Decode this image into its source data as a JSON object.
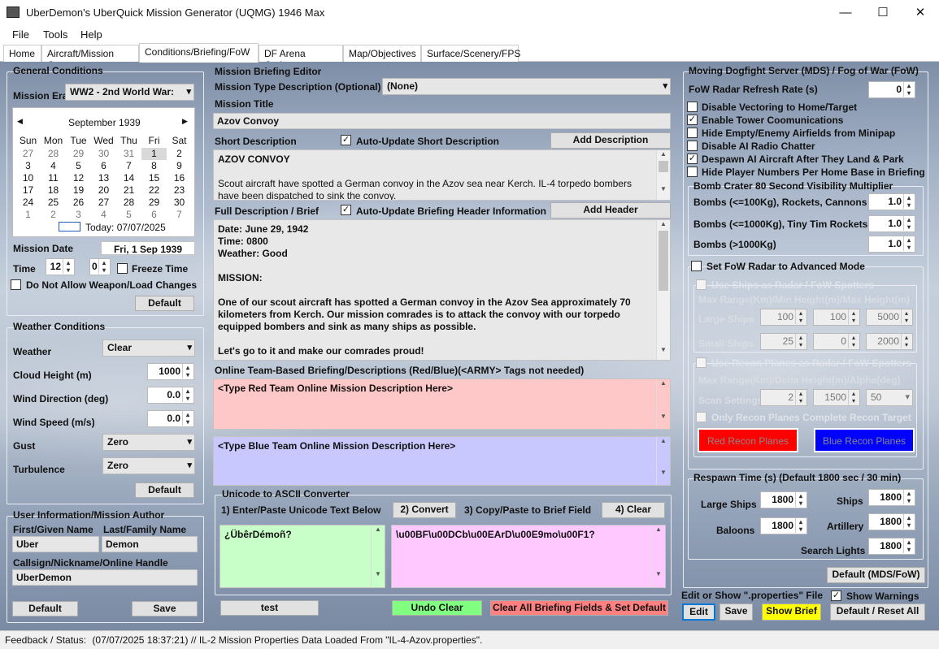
{
  "window": {
    "title": "UberDemon's UberQuick Mission Generator (UQMG) 1946 Max",
    "minimize": "—",
    "maximize": "☐",
    "close": "✕"
  },
  "menu": [
    "File",
    "Tools",
    "Help"
  ],
  "tabs": [
    "Home",
    "Aircraft/Mission Gen",
    "Conditions/Briefing/FoW",
    "DF Arena Options",
    "Map/Objectives",
    "Surface/Scenery/FPS"
  ],
  "general": {
    "title": "General Conditions",
    "era_label": "Mission Era",
    "era_value": "WW2 - 2nd World War:",
    "calendar": {
      "month": "September 1939",
      "prev": "◀",
      "next": "▶",
      "days": [
        "Sun",
        "Mon",
        "Tue",
        "Wed",
        "Thu",
        "Fri",
        "Sat"
      ],
      "weeks": [
        [
          "27",
          "28",
          "29",
          "30",
          "31",
          "1",
          "2"
        ],
        [
          "3",
          "4",
          "5",
          "6",
          "7",
          "8",
          "9"
        ],
        [
          "10",
          "11",
          "12",
          "13",
          "14",
          "15",
          "16"
        ],
        [
          "17",
          "18",
          "19",
          "20",
          "21",
          "22",
          "23"
        ],
        [
          "24",
          "25",
          "26",
          "27",
          "28",
          "29",
          "30"
        ],
        [
          "1",
          "2",
          "3",
          "4",
          "5",
          "6",
          "7"
        ]
      ],
      "today": "Today: 07/07/2025"
    },
    "date_label": "Mission Date",
    "date_value": "Fri, 1 Sep 1939",
    "time_label": "Time",
    "hour": "12",
    "minute": "0",
    "freeze_label": "Freeze Time",
    "no_weapon_label": "Do Not Allow Weapon/Load Changes",
    "default_btn": "Default"
  },
  "weather": {
    "title": "Weather Conditions",
    "weather_label": "Weather",
    "weather_value": "Clear",
    "cloud_label": "Cloud Height (m)",
    "cloud_value": "1000",
    "winddir_label": "Wind Direction (deg)",
    "winddir_value": "0.0",
    "windspeed_label": "Wind Speed (m/s)",
    "windspeed_value": "0.0",
    "gust_label": "Gust",
    "gust_value": "Zero",
    "turb_label": "Turbulence",
    "turb_value": "Zero",
    "default_btn": "Default"
  },
  "author": {
    "title": "User Information/Mission Author",
    "first_label": "First/Given Name",
    "first_value": "Uber",
    "last_label": "Last/Family Name",
    "last_value": "Demon",
    "callsign_label": "Callsign/Nickname/Online Handle",
    "callsign_value": "UberDemon",
    "default_btn": "Default",
    "save_btn": "Save"
  },
  "briefing": {
    "title": "Mission Briefing Editor",
    "type_label": "Mission Type Description (Optional)",
    "type_value": "(None)",
    "mtitle_label": "Mission Title",
    "mtitle_value": "Azov Convoy",
    "short_label": "Short Description",
    "auto_short_label": "Auto-Update Short Description",
    "add_desc_btn": "Add Description",
    "short_lines": [
      "AZOV CONVOY",
      "",
      "Scout aircraft have spotted a German convoy in the Azov sea near Kerch. IL-4 torpedo bombers",
      "have been dispatched to sink the convoy."
    ],
    "full_label": "Full Description / Brief",
    "auto_header_label": "Auto-Update Briefing Header Information",
    "add_header_btn": "Add Header",
    "full_lines": [
      "Date: June 29, 1942",
      "Time: 0800",
      "Weather: Good",
      "",
      "MISSION:",
      "",
      "One of our scout aircraft has spotted a German convoy in the Azov Sea approximately 70",
      "kilometers from Kerch. Our mission comrades is to attack the convoy with our torpedo",
      "equipped bombers and sink as many ships as possible.",
      "",
      "Let's go to it and make our comrades proud!"
    ],
    "online_label": "Online Team-Based Briefing/Descriptions (Red/Blue)(<ARMY> Tags not needed)",
    "red_text": "<Type Red Team Online Mission Description Here>",
    "blue_text": "<Type Blue Team Online Mission Description Here>",
    "unicode_title": "Unicode to ASCII Converter",
    "step1": "1) Enter/Paste Unicode Text Below",
    "convert_btn": "2) Convert",
    "step3": "3) Copy/Paste to Brief Field",
    "clear_btn": "4) Clear",
    "unicode_in": "¿ÜbêrDémoñ?",
    "unicode_out": "\\u00BF\\u00DCb\\u00EArD\\u00E9mo\\u00F1?",
    "test_btn": "test",
    "undo_btn": "Undo Clear",
    "clear_all_btn": "Clear All Briefing Fields & Set Default"
  },
  "fow": {
    "title": "Moving Dogfight Server (MDS) / Fog of War (FoW)",
    "refresh_label": "FoW Radar Refresh Rate (s)",
    "refresh_value": "0",
    "checks": [
      {
        "label": "Disable Vectoring to Home/Target",
        "checked": ""
      },
      {
        "label": "Enable Tower Coomunications",
        "checked": "✓"
      },
      {
        "label": "Hide Empty/Enemy Airfields from Minipap",
        "checked": ""
      },
      {
        "label": "Disable AI Radio Chatter",
        "checked": ""
      },
      {
        "label": "Despawn AI Aircraft After They Land & Park",
        "checked": "✓"
      },
      {
        "label": "Hide Player Numbers Per Home Base in Briefing",
        "checked": ""
      }
    ],
    "crater_title": "Bomb Crater 80 Second Visibility Multiplier",
    "crater": [
      {
        "label": "Bombs (<=100Kg), Rockets, Cannons",
        "value": "1.0"
      },
      {
        "label": "Bombs (<=1000Kg), Tiny Tim Rockets",
        "value": "1.0"
      },
      {
        "label": "Bombs (>1000Kg)",
        "value": "1.0"
      }
    ],
    "advanced_label": "Set FoW Radar to Advanced Mode",
    "ships_label": "Use Ships as Radar / FoW Spotters",
    "ships_header": "Max Range(Km)/Min Height(m)/Max Height(m)",
    "large_ships": {
      "label": "Large Ships",
      "v1": "100",
      "v2": "100",
      "v3": "5000"
    },
    "small_ships": {
      "label": "Small Ships",
      "v1": "25",
      "v2": "0",
      "v3": "2000"
    },
    "recon_label": "Use Recon Planes as Radar / FoW Spotters",
    "recon_header": "Max Range(Km)/Delta Height(m)/Alpha(deg)",
    "scan": {
      "label": "Scan Settings",
      "v1": "2",
      "v2": "1500",
      "v3": "50"
    },
    "only_recon_label": "Only Recon Planes Complete Recon Target",
    "red_recon_btn": "Red Recon Planes",
    "blue_recon_btn": "Blue Recon Planes",
    "respawn_title": "Respawn Time (s) (Default 1800 sec / 30 min)",
    "respawn": {
      "large_ships": {
        "label": "Large Ships",
        "value": "1800"
      },
      "ships": {
        "label": "Ships",
        "value": "1800"
      },
      "baloons": {
        "label": "Baloons",
        "value": "1800"
      },
      "artillery": {
        "label": "Artillery",
        "value": "1800"
      },
      "search": {
        "label": "Search Lights",
        "value": "1800"
      }
    },
    "default_btn": "Default (MDS/FoW)",
    "edit_label": "Edit or Show \".properties\" File",
    "show_warn_label": "Show Warnings",
    "edit_btn": "Edit",
    "save_btn": "Save",
    "show_brief_btn": "Show Brief",
    "reset_btn": "Default / Reset All"
  },
  "status": {
    "label": "Feedback / Status:",
    "text": "(07/07/2025 18:37:21) // IL-2 Mission Properties Data Loaded From \"IL-4-Azov.properties\"."
  },
  "colors": {
    "red_field": "#ffc8c8",
    "blue_field": "#c8c8ff",
    "green_field": "#c8ffc8",
    "pink_field": "#ffc8ff",
    "red_btn": "#ff0000",
    "blue_btn": "#0000ff",
    "yellow_btn": "#ffff00",
    "green_btn": "#80ff80",
    "salmon_btn": "#ff8080"
  }
}
